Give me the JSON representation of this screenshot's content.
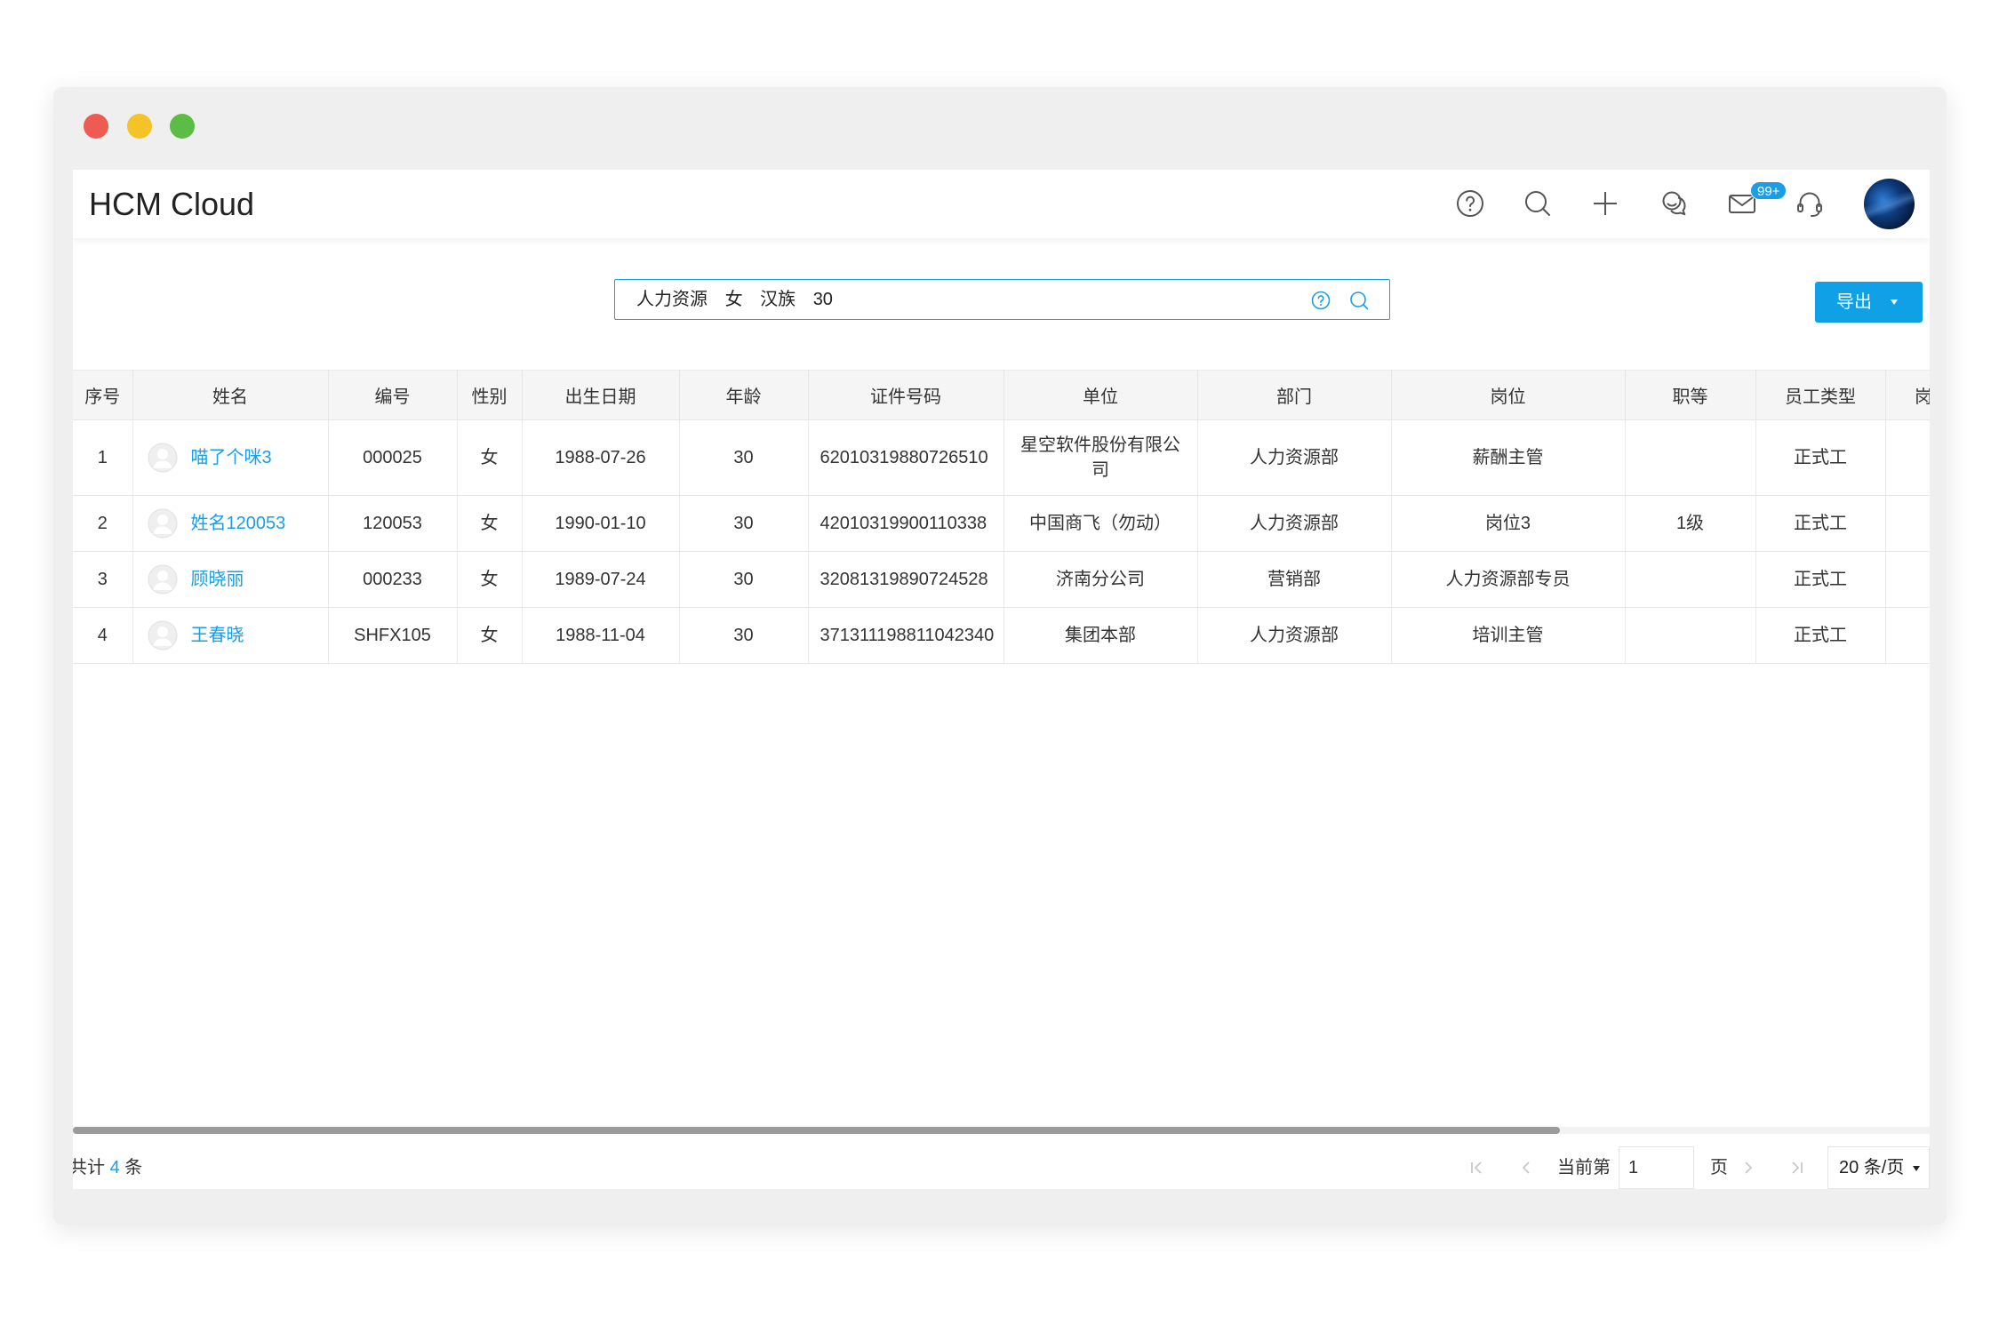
{
  "app": {
    "title": "HCM Cloud"
  },
  "header": {
    "icons": {
      "help": "help-icon",
      "search": "search-icon",
      "add": "plus-icon",
      "contacts": "chat-icon",
      "mail": "mail-icon",
      "service": "headset-icon",
      "profile": "user-avatar"
    },
    "mail_badge": "99+"
  },
  "search": {
    "tokens": [
      "人力资源",
      "女",
      "汉族",
      "30"
    ],
    "icons": [
      "help-circle-icon",
      "search-icon"
    ]
  },
  "toolbar": {
    "export_label": "导出",
    "export_icon": "caret-down-icon"
  },
  "table": {
    "columns": [
      "序号",
      "姓名",
      "编号",
      "性别",
      "出生日期",
      "年龄",
      "证件号码",
      "单位",
      "部门",
      "岗位",
      "职等",
      "员工类型",
      "岗"
    ],
    "rows": [
      {
        "index": "1",
        "name": "喵了个咪3",
        "code": "000025",
        "gender": "女",
        "birth_date": "1988-07-26",
        "age": "30",
        "id_number": "62010319880726510",
        "unit": "星空软件股份有限公司",
        "department": "人力资源部",
        "position": "薪酬主管",
        "grade": "",
        "employee_type": "正式工"
      },
      {
        "index": "2",
        "name": "姓名120053",
        "code": "120053",
        "gender": "女",
        "birth_date": "1990-01-10",
        "age": "30",
        "id_number": "42010319900110338",
        "unit": "中国商飞（勿动）",
        "department": "人力资源部",
        "position": "岗位3",
        "grade": "1级",
        "employee_type": "正式工"
      },
      {
        "index": "3",
        "name": "顾晓丽",
        "code": "000233",
        "gender": "女",
        "birth_date": "1989-07-24",
        "age": "30",
        "id_number": "32081319890724528",
        "unit": "济南分公司",
        "department": "营销部",
        "position": "人力资源部专员",
        "grade": "",
        "employee_type": "正式工"
      },
      {
        "index": "4",
        "name": "王春晓",
        "code": "SHFX105",
        "gender": "女",
        "birth_date": "1988-11-04",
        "age": "30",
        "id_number": "371311198811042340",
        "unit": "集团本部",
        "department": "人力资源部",
        "position": "培训主管",
        "grade": "",
        "employee_type": "正式工"
      }
    ]
  },
  "footer": {
    "total_prefix": "共计",
    "total_count": "4",
    "total_suffix": "条",
    "current_page_label": "当前第",
    "current_page": "1",
    "page_suffix": "页",
    "page_size": "20 条/页",
    "icons": [
      "first-page-icon",
      "prev-page-icon",
      "next-page-icon",
      "last-page-icon",
      "caret-down-icon"
    ]
  },
  "colors": {
    "accent": "#1a9ee5",
    "export_button": "#0fa0e6",
    "table_header_bg": "#f5f5f5",
    "window_frame": "#efefef",
    "traffic_red": "#ed5b52",
    "traffic_yellow": "#f4c328",
    "traffic_green": "#5bbd46"
  }
}
